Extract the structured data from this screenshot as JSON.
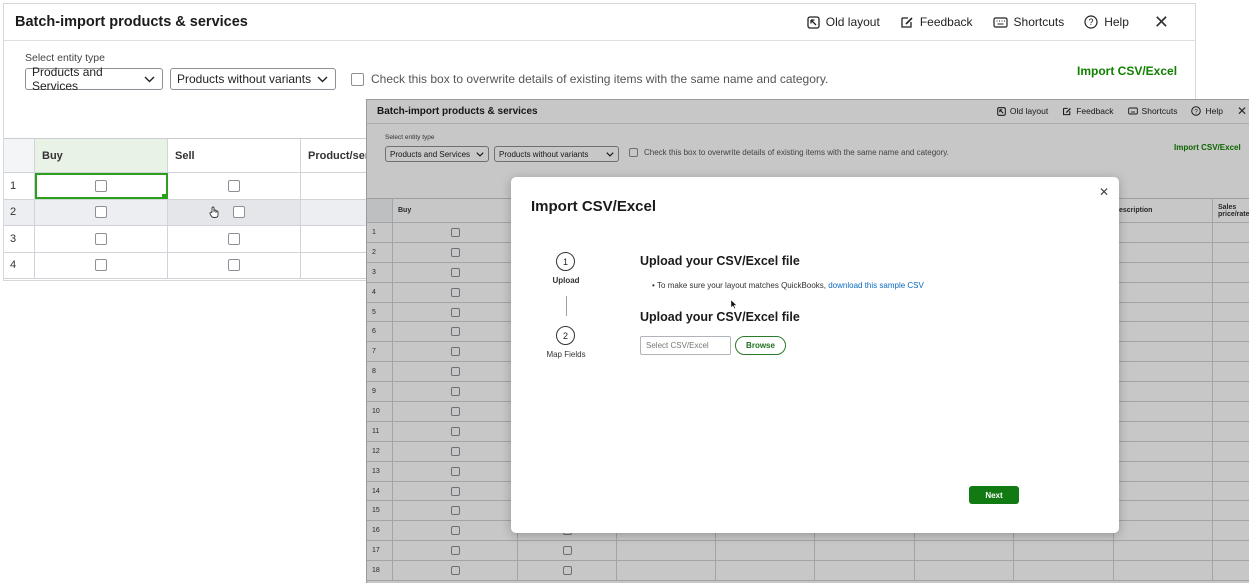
{
  "back_window": {
    "title": "Batch-import products & services",
    "actions": {
      "old_layout": "Old layout",
      "feedback": "Feedback",
      "shortcuts": "Shortcuts",
      "help": "Help"
    },
    "entity_label": "Select entity type",
    "entity_select": "Products and Services",
    "variant_select": "Products without variants",
    "overwrite_label": "Check this box to overwrite details of existing items with the same name and category.",
    "import_link": "Import CSV/Excel",
    "columns": [
      "Buy",
      "Sell",
      "Product/servi"
    ],
    "rows": [
      "1",
      "2",
      "3",
      "4"
    ]
  },
  "front_window": {
    "title": "Batch-import products & services",
    "actions": {
      "old_layout": "Old layout",
      "feedback": "Feedback",
      "shortcuts": "Shortcuts",
      "help": "Help"
    },
    "entity_label": "Select entity type",
    "entity_select": "Products and Services",
    "variant_select": "Products without variants",
    "overwrite_label": "Check this box to overwrite details of existing items with the same name and category.",
    "import_link": "Import CSV/Excel",
    "columns": [
      "Buy",
      "Sell",
      "",
      "",
      "",
      "",
      "",
      "escription",
      "Sales price/rate"
    ],
    "rows": [
      "1",
      "2",
      "3",
      "4",
      "5",
      "6",
      "7",
      "8",
      "9",
      "10",
      "11",
      "12",
      "13",
      "14",
      "15",
      "16",
      "17",
      "18"
    ]
  },
  "modal": {
    "title": "Import CSV/Excel",
    "steps": [
      {
        "number": "1",
        "label": "Upload"
      },
      {
        "number": "2",
        "label": "Map Fields"
      }
    ],
    "heading_1": "Upload your CSV/Excel file",
    "bullet_text": "To make sure your layout matches QuickBooks,",
    "bullet_link": "download this sample CSV",
    "heading_2": "Upload your CSV/Excel file",
    "file_placeholder": "Select CSV/Excel",
    "browse_label": "Browse",
    "next_label": "Next"
  },
  "colors": {
    "brand_green": "#108000",
    "button_green": "#117a12",
    "link_blue": "#0b6abf"
  }
}
